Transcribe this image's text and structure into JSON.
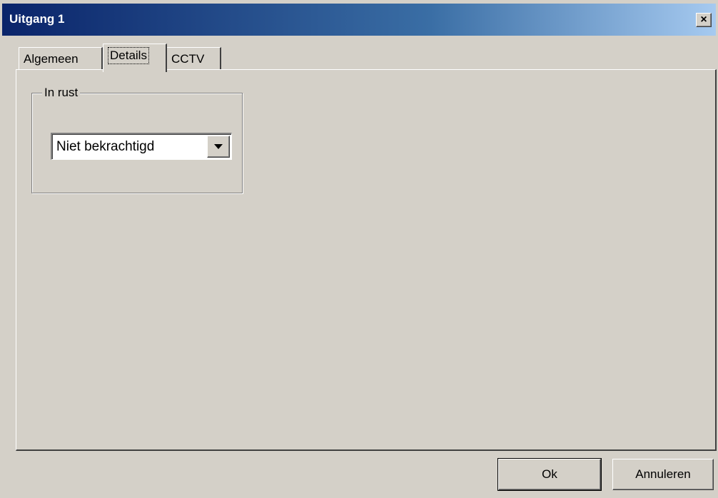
{
  "window": {
    "title": "Uitgang 1",
    "close_label": "×"
  },
  "tabs": [
    {
      "label": "Algemeen",
      "selected": false
    },
    {
      "label": "Details",
      "selected": true
    },
    {
      "label": "CCTV",
      "selected": false
    }
  ],
  "details": {
    "group_label": "In rust",
    "combo_value": "Niet bekrachtigd"
  },
  "buttons": {
    "ok_label": "Ok",
    "cancel_label": "Annuleren"
  }
}
